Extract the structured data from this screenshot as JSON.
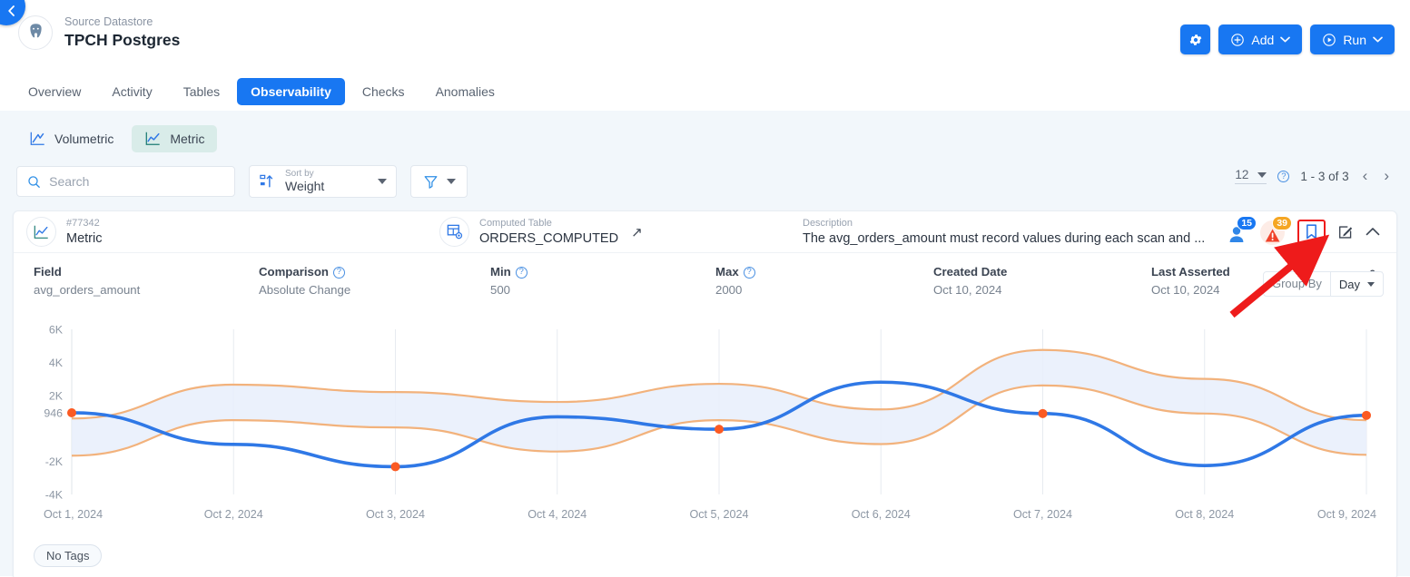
{
  "nav": {
    "back_icon": "chevron-left-icon"
  },
  "header": {
    "subtitle": "Source Datastore",
    "title": "TPCH Postgres",
    "logo_icon": "postgres-elephant-icon",
    "actions": {
      "settings_icon": "gear-icon",
      "add_label": "Add",
      "add_icon": "plus-circle-icon",
      "run_label": "Run",
      "run_icon": "play-circle-icon",
      "caret_icon": "chevron-down-icon"
    }
  },
  "tabs": [
    {
      "label": "Overview",
      "active": false
    },
    {
      "label": "Activity",
      "active": false
    },
    {
      "label": "Tables",
      "active": false
    },
    {
      "label": "Observability",
      "active": true
    },
    {
      "label": "Checks",
      "active": false
    },
    {
      "label": "Anomalies",
      "active": false
    }
  ],
  "segments": [
    {
      "label": "Volumetric",
      "icon": "volumetric-chart-icon",
      "active": false
    },
    {
      "label": "Metric",
      "icon": "metric-chart-icon",
      "active": true
    }
  ],
  "filters": {
    "search_placeholder": "Search",
    "search_value": "",
    "search_icon": "search-icon",
    "sort_label": "Sort by",
    "sort_value": "Weight",
    "sort_icon": "sort-ascending-icon",
    "filter_icon": "funnel-icon"
  },
  "pagination": {
    "page_size": "12",
    "help_icon": "help-circle-icon",
    "range": "1 - 3 of 3",
    "prev_icon": "chevron-left-icon",
    "next_icon": "chevron-right-icon"
  },
  "card": {
    "type_label": "#77342",
    "type_value": "Metric",
    "type_icon": "metric-chart-icon",
    "table_label": "Computed Table",
    "table_value": "ORDERS_COMPUTED",
    "table_icon": "computed-table-icon",
    "external_link_icon": "external-link-icon",
    "description_label": "Description",
    "description_value": "The avg_orders_amount must record values during each scan and ...",
    "badges": {
      "people_count": "15",
      "people_icon": "person-icon",
      "alert_count": "39",
      "alert_icon": "warning-triangle-icon"
    },
    "bookmark_icon": "bookmark-icon",
    "edit_icon": "edit-square-icon",
    "collapse_icon": "chevron-up-icon",
    "settings_icon": "sliders-icon",
    "meta": [
      {
        "label": "Field",
        "value": "avg_orders_amount",
        "help": false
      },
      {
        "label": "Comparison",
        "value": "Absolute Change",
        "help": true
      },
      {
        "label": "Min",
        "value": "500",
        "help": true
      },
      {
        "label": "Max",
        "value": "2000",
        "help": true
      },
      {
        "label": "Created Date",
        "value": "Oct 10, 2024",
        "help": false
      },
      {
        "label": "Last Asserted",
        "value": "Oct 10, 2024",
        "help": false
      }
    ],
    "group_by": {
      "label": "Group By",
      "value": "Day",
      "caret_icon": "chevron-down-icon"
    },
    "tags": {
      "empty_label": "No Tags"
    }
  },
  "chart_data": {
    "type": "line",
    "title": "",
    "xlabel": "",
    "ylabel": "",
    "grid": true,
    "legend": "none",
    "ylim": [
      -4000,
      6000
    ],
    "ytick_labels": [
      "6K",
      "4K",
      "2K",
      "946",
      "-2K",
      "-4K"
    ],
    "ytick_values": [
      6000,
      4000,
      2000,
      946,
      -2000,
      -4000
    ],
    "highlight_tick": "946",
    "x": [
      "Oct 1, 2024",
      "Oct 2, 2024",
      "Oct 3, 2024",
      "Oct 4, 2024",
      "Oct 5, 2024",
      "Oct 6, 2024",
      "Oct 7, 2024",
      "Oct 8, 2024",
      "Oct 9, 2024"
    ],
    "series": [
      {
        "name": "avg_orders_amount",
        "type": "line",
        "color": "#2f78e6",
        "marker_color": "#fb5a23",
        "values": [
          946,
          -970,
          -2320,
          700,
          -50,
          2800,
          900,
          -2250,
          790
        ]
      },
      {
        "name": "upper_bound",
        "type": "band-upper",
        "color": "#f2b27c",
        "values": [
          600,
          2650,
          2200,
          1600,
          2700,
          1150,
          4750,
          3000,
          500
        ]
      },
      {
        "name": "lower_bound",
        "type": "band-lower",
        "color": "#f2b27c",
        "values": [
          -1650,
          500,
          60,
          -1400,
          500,
          -950,
          2600,
          900,
          -1600
        ]
      }
    ],
    "band_fill": "#e8effb"
  },
  "annotation": {
    "arrow_color": "#ee1b1b",
    "highlight_color": "#ef1b1b",
    "points_to": "bookmark-icon"
  }
}
